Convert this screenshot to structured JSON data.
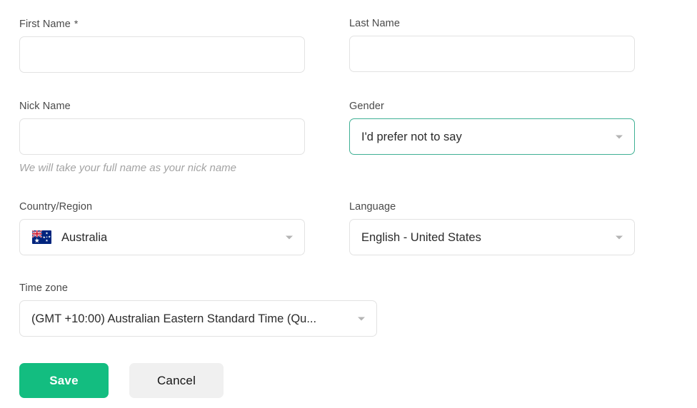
{
  "form": {
    "fields": {
      "first_name": {
        "label": "First Name",
        "required_marker": "*",
        "value": "",
        "placeholder": ""
      },
      "last_name": {
        "label": "Last Name",
        "value": "",
        "placeholder": ""
      },
      "nick_name": {
        "label": "Nick Name",
        "value": "",
        "placeholder": "",
        "helper": "We will take your full name as your nick name"
      },
      "gender": {
        "label": "Gender",
        "value": "I'd prefer not to say",
        "caret_icon": "chevron-down-icon",
        "focused": true
      },
      "country_region": {
        "label": "Country/Region",
        "value": "Australia",
        "flag_icon": "australia-flag-icon",
        "caret_icon": "chevron-down-icon"
      },
      "language": {
        "label": "Language",
        "value": "English - United States",
        "caret_icon": "chevron-down-icon"
      },
      "time_zone": {
        "label": "Time zone",
        "value": "(GMT +10:00) Australian Eastern Standard Time (Qu...",
        "caret_icon": "chevron-down-icon"
      }
    },
    "actions": {
      "save_label": "Save",
      "cancel_label": "Cancel"
    },
    "colors": {
      "save_background": "#13bd80",
      "save_text": "#ffffff",
      "cancel_background": "#f0f0f0",
      "cancel_text": "#141414",
      "focus_border": "#3fb094",
      "field_border": "#e2e2e2",
      "label_text": "#4a4a4a",
      "helper_text": "#a3a3a3"
    }
  }
}
